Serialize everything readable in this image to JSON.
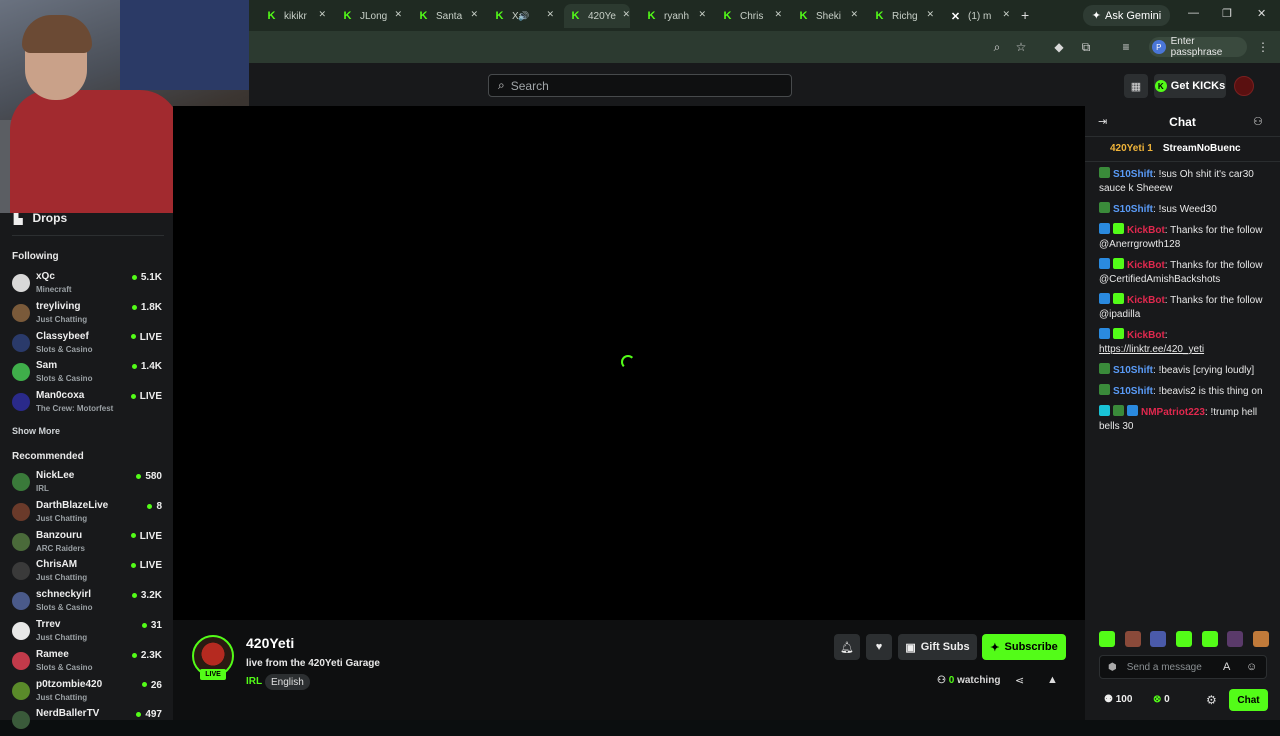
{
  "browser": {
    "tabs": [
      {
        "title": "kikikr",
        "favicon": "kick-icon"
      },
      {
        "title": "JLong",
        "favicon": "kick-icon"
      },
      {
        "title": "Santa",
        "favicon": "kick-icon"
      },
      {
        "title": "Xa",
        "favicon": "kick-icon",
        "audio": "🔊"
      },
      {
        "title": "420Ye",
        "favicon": "kick-icon",
        "active": true
      },
      {
        "title": "ryanh",
        "favicon": "kick-icon"
      },
      {
        "title": "Chris",
        "favicon": "kick-icon"
      },
      {
        "title": "Sheki",
        "favicon": "kick-icon"
      },
      {
        "title": "Richg",
        "favicon": "kick-icon"
      },
      {
        "title": "(1) m",
        "favicon": "x-icon"
      }
    ],
    "new_tab": "+",
    "ask_gemini": "Ask Gemini",
    "window_controls": {
      "minimize": "—",
      "restore": "❐",
      "close": "✕"
    },
    "passphrase": "Enter passphrase",
    "passphrase_avatar": "P"
  },
  "header": {
    "search_placeholder": "Search",
    "get_kicks": "Get KICKs"
  },
  "sidebar": {
    "drops": "Drops",
    "following_title": "Following",
    "following": [
      {
        "name": "xQc",
        "category": "Minecraft",
        "viewers": "5.1K",
        "avatar_color": "#d8d8d8"
      },
      {
        "name": "treyliving",
        "category": "Just Chatting",
        "viewers": "1.8K",
        "avatar_color": "#7a5a3a"
      },
      {
        "name": "Classybeef",
        "category": "Slots & Casino",
        "viewers": "LIVE",
        "avatar_color": "#2a3a6a"
      },
      {
        "name": "Sam",
        "category": "Slots & Casino",
        "viewers": "1.4K",
        "avatar_color": "#3fae4a"
      },
      {
        "name": "Man0coxa",
        "category": "The Crew: Motorfest",
        "viewers": "LIVE",
        "avatar_color": "#2a2a8a"
      }
    ],
    "show_more": "Show More",
    "recommended_title": "Recommended",
    "recommended": [
      {
        "name": "NickLee",
        "category": "IRL",
        "viewers": "580",
        "avatar_color": "#3a7a3a"
      },
      {
        "name": "DarthBlazeLive",
        "category": "Just Chatting",
        "viewers": "8",
        "avatar_color": "#6a3a2a"
      },
      {
        "name": "Banzouru",
        "category": "ARC Raiders",
        "viewers": "LIVE",
        "avatar_color": "#4a6a3a"
      },
      {
        "name": "ChrisAM",
        "category": "Just Chatting",
        "viewers": "LIVE",
        "avatar_color": "#3a3a3a"
      },
      {
        "name": "schneckyirl",
        "category": "Slots & Casino",
        "viewers": "3.2K",
        "avatar_color": "#4a5a8a"
      },
      {
        "name": "Trrev",
        "category": "Just Chatting",
        "viewers": "31",
        "avatar_color": "#e8e8e8"
      },
      {
        "name": "Ramee",
        "category": "Slots & Casino",
        "viewers": "2.3K",
        "avatar_color": "#c23a4a"
      },
      {
        "name": "p0tzombie420",
        "category": "Just Chatting",
        "viewers": "26",
        "avatar_color": "#5a8a2a"
      },
      {
        "name": "NerdBallerTV",
        "category": "",
        "viewers": "497",
        "avatar_color": "#3a5a3a"
      }
    ]
  },
  "stream": {
    "name": "420Yeti",
    "title": "live from the 420Yeti Garage",
    "category": "IRL",
    "language": "English",
    "live": "LIVE",
    "gift_subs": "Gift Subs",
    "subscribe": "Subscribe",
    "watching_count": "0",
    "watching_label": "watching"
  },
  "chat": {
    "title": "Chat",
    "pinned": [
      "420Yeti 1",
      "StreamNoBuenc"
    ],
    "messages": [
      {
        "user": "S10Shift",
        "style": "u1",
        "badges": [
          "#3a8a3a"
        ],
        "text": ": !sus Oh shit it's car30 sauce k Sheeew"
      },
      {
        "user": "S10Shift",
        "style": "u1",
        "badges": [
          "#3a8a3a"
        ],
        "text": ": !sus Weed30"
      },
      {
        "user": "KickBot",
        "style": "u2",
        "badges": [
          "#2a8adf",
          "#53fc18"
        ],
        "text": ": Thanks for the follow @Anerrgrowth128"
      },
      {
        "user": "KickBot",
        "style": "u2",
        "badges": [
          "#2a8adf",
          "#53fc18"
        ],
        "text": ": Thanks for the follow @CertifiedAmishBackshots"
      },
      {
        "user": "KickBot",
        "style": "u2",
        "badges": [
          "#2a8adf",
          "#53fc18"
        ],
        "text": ": Thanks for the follow @ipadilla"
      },
      {
        "user": "KickBot",
        "style": "u2",
        "badges": [
          "#2a8adf",
          "#53fc18"
        ],
        "text": ":",
        "link": "https://linktr.ee/420_yeti"
      },
      {
        "user": "S10Shift",
        "style": "u1",
        "badges": [
          "#3a8a3a"
        ],
        "text": ": !beavis [crying loudly]"
      },
      {
        "user": "S10Shift",
        "style": "u1",
        "badges": [
          "#3a8a3a"
        ],
        "text": ": !beavis2 is this thing on"
      },
      {
        "user": "NMPatriot223",
        "style": "u2",
        "badges": [
          "#19c3d6",
          "#3a8a3a",
          "#2a8adf"
        ],
        "text": ": !trump hell bells 30"
      }
    ],
    "emote_colors": [
      "#53fc18",
      "#8a4a3a",
      "#4a5aaa",
      "#53fc18",
      "#53fc18",
      "#5a3a6a",
      "#c07a3a"
    ],
    "input_placeholder": "Send a message",
    "points": "100",
    "kicks": "0",
    "chat_button": "Chat"
  },
  "colors": {
    "accent": "#53fc18",
    "background": "#0b0e0f",
    "panel": "#18191b"
  }
}
